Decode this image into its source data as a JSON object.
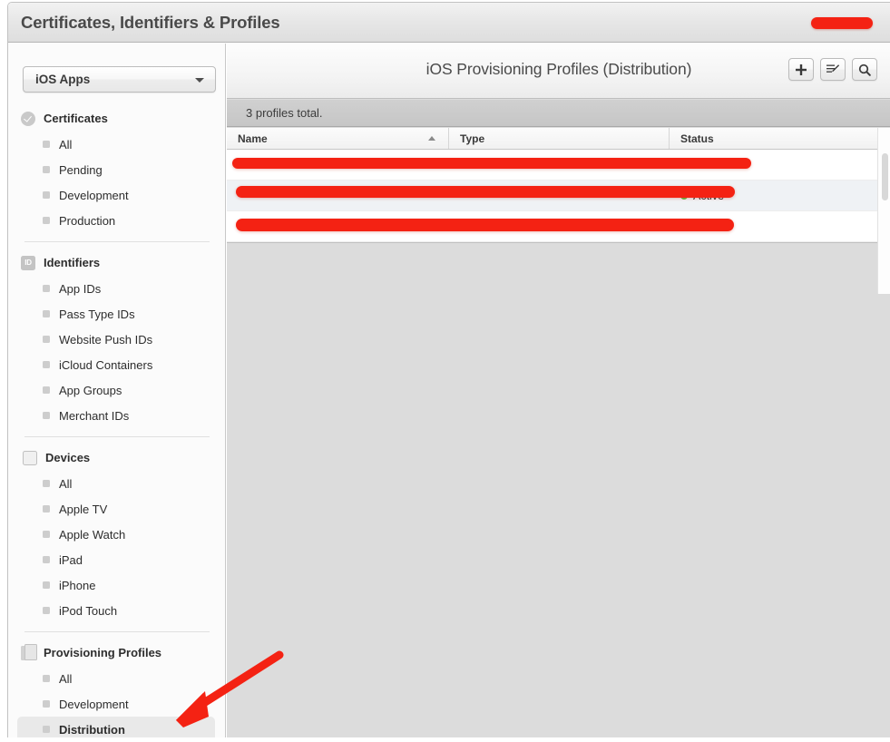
{
  "window": {
    "title": "Certificates, Identifiers & Profiles",
    "title_redaction_name": "redacted-account-name"
  },
  "sidebar": {
    "app_select": {
      "value": "iOS Apps",
      "caret_icon": "chevron-down-icon"
    },
    "groups": [
      {
        "id": "certificates",
        "header": "Certificates",
        "icon": "certificate-seal-icon",
        "items": [
          {
            "label": "All",
            "selected": false
          },
          {
            "label": "Pending",
            "selected": false
          },
          {
            "label": "Development",
            "selected": false
          },
          {
            "label": "Production",
            "selected": false
          }
        ]
      },
      {
        "id": "identifiers",
        "header": "Identifiers",
        "icon": "id-badge-icon",
        "icon_text": "ID",
        "items": [
          {
            "label": "App IDs",
            "selected": false
          },
          {
            "label": "Pass Type IDs",
            "selected": false
          },
          {
            "label": "Website Push IDs",
            "selected": false
          },
          {
            "label": "iCloud Containers",
            "selected": false
          },
          {
            "label": "App Groups",
            "selected": false
          },
          {
            "label": "Merchant IDs",
            "selected": false
          }
        ]
      },
      {
        "id": "devices",
        "header": "Devices",
        "icon": "device-phone-icon",
        "items": [
          {
            "label": "All",
            "selected": false
          },
          {
            "label": "Apple TV",
            "selected": false
          },
          {
            "label": "Apple Watch",
            "selected": false
          },
          {
            "label": "iPad",
            "selected": false
          },
          {
            "label": "iPhone",
            "selected": false
          },
          {
            "label": "iPod Touch",
            "selected": false
          }
        ]
      },
      {
        "id": "provisioning-profiles",
        "header": "Provisioning Profiles",
        "icon": "document-stack-icon",
        "items": [
          {
            "label": "All",
            "selected": false
          },
          {
            "label": "Development",
            "selected": false
          },
          {
            "label": "Distribution",
            "selected": true
          }
        ]
      }
    ]
  },
  "main": {
    "title": "iOS Provisioning Profiles (Distribution)",
    "toolbar_buttons": [
      {
        "name": "add-profile-button",
        "icon": "plus-icon"
      },
      {
        "name": "edit-profile-button",
        "icon": "edit-pencil-icon"
      },
      {
        "name": "search-button",
        "icon": "search-icon"
      }
    ],
    "count_text": "3 profiles total.",
    "table": {
      "columns": [
        {
          "key": "name",
          "label": "Name",
          "sort": "ascending"
        },
        {
          "key": "type",
          "label": "Type",
          "sort": null
        },
        {
          "key": "status",
          "label": "Status",
          "sort": null
        }
      ],
      "rows": [
        {
          "name": "",
          "type": "",
          "status": "",
          "status_dot": true,
          "redacted": true
        },
        {
          "name": "",
          "type": "",
          "status": "Active",
          "status_dot": true,
          "redacted": true
        },
        {
          "name": "",
          "type": "",
          "status": "",
          "status_dot": false,
          "redacted": true
        }
      ]
    }
  },
  "annotations": {
    "arrow": {
      "name": "callout-arrow",
      "color": "#f42213",
      "points_to": "Distribution"
    },
    "redaction_color": "#f42213"
  }
}
